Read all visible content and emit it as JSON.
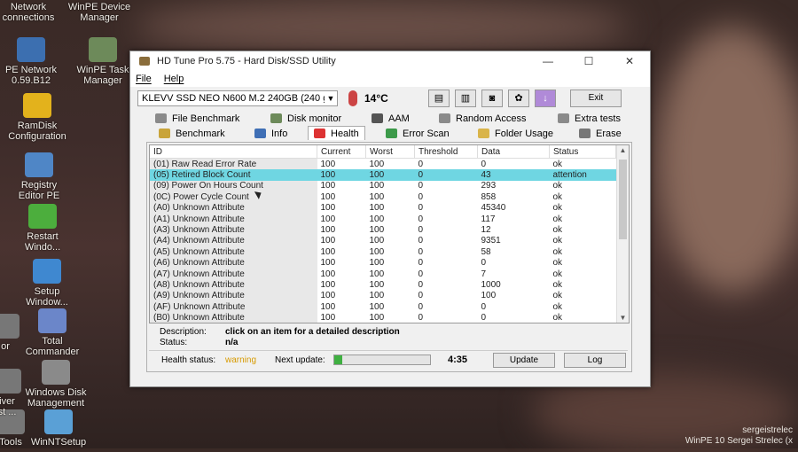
{
  "desktop": {
    "icons": [
      {
        "label1": "Network",
        "label2": "connections",
        "icon": "network-icon",
        "color": "#4a7fbf"
      },
      {
        "label1": "WinPE Device",
        "label2": "Manager",
        "icon": "device-manager-icon",
        "color": "#7a8ea8"
      },
      {
        "label1": "PE Network",
        "label2": "0.59.B12",
        "icon": "pe-network-icon",
        "color": "#3c6fb0"
      },
      {
        "label1": "WinPE Task",
        "label2": "Manager",
        "icon": "task-manager-icon",
        "color": "#6d8a5a"
      },
      {
        "label1": "RamDisk",
        "label2": "Configuration",
        "icon": "ramdisk-icon",
        "color": "#e3b21c"
      },
      {
        "label1": "Registry",
        "label2": "Editor PE",
        "icon": "registry-icon",
        "color": "#4f86c6"
      },
      {
        "label1": "Restart",
        "label2": "Windo...",
        "icon": "restart-icon",
        "color": "#4cae3d"
      },
      {
        "label1": "Setup",
        "label2": "Window...",
        "icon": "setup-icon",
        "color": "#3f88d0"
      },
      {
        "label1": "Total",
        "label2": "Commander",
        "icon": "total-commander-icon",
        "color": "#6b86c9"
      },
      {
        "label1": "Windows Disk",
        "label2": "Management",
        "icon": "disk-management-icon",
        "color": "#8a8a8a"
      },
      {
        "label1": "WinNTSetup",
        "label2": "",
        "icon": "winntsetup-icon",
        "color": "#5aa0d6"
      },
      {
        "label1": "Tools",
        "label2": "",
        "icon": "tools-icon",
        "color": "#777"
      },
      {
        "label1": "iver",
        "label2": "st ...",
        "icon": "driver-icon",
        "color": "#777"
      },
      {
        "label1": "or",
        "label2": "",
        "icon": "partial-icon",
        "color": "#777"
      }
    ],
    "tray_line1": "sergeistrelec",
    "tray_line2": "WinPE 10 Sergei Strelec (x"
  },
  "window": {
    "title": "HD Tune Pro 5.75 - Hard Disk/SSD Utility",
    "minimize": "—",
    "maximize": "☐",
    "close": "✕",
    "menu": [
      "File",
      "Help"
    ],
    "drive": "KLEVV SSD NEO N600 M.2 240GB (240 g",
    "temperature": "14°C",
    "exit_label": "Exit",
    "tabs_top": [
      "File Benchmark",
      "Disk monitor",
      "AAM",
      "Random Access",
      "Extra tests"
    ],
    "tabs_bottom": [
      "Benchmark",
      "Info",
      "Health",
      "Error Scan",
      "Folder Usage",
      "Erase"
    ],
    "active_tab": "Health"
  },
  "health": {
    "columns": [
      "ID",
      "Current",
      "Worst",
      "Threshold",
      "Data",
      "Status"
    ],
    "rows": [
      {
        "id": "(01) Raw Read Error Rate",
        "current": "100",
        "worst": "100",
        "threshold": "0",
        "data": "0",
        "status": "ok"
      },
      {
        "id": "(05) Retired Block Count",
        "current": "100",
        "worst": "100",
        "threshold": "0",
        "data": "43",
        "status": "attention"
      },
      {
        "id": "(09) Power On Hours Count",
        "current": "100",
        "worst": "100",
        "threshold": "0",
        "data": "293",
        "status": "ok"
      },
      {
        "id": "(0C) Power Cycle Count",
        "current": "100",
        "worst": "100",
        "threshold": "0",
        "data": "858",
        "status": "ok"
      },
      {
        "id": "(A0) Unknown Attribute",
        "current": "100",
        "worst": "100",
        "threshold": "0",
        "data": "45340",
        "status": "ok"
      },
      {
        "id": "(A1) Unknown Attribute",
        "current": "100",
        "worst": "100",
        "threshold": "0",
        "data": "117",
        "status": "ok"
      },
      {
        "id": "(A3) Unknown Attribute",
        "current": "100",
        "worst": "100",
        "threshold": "0",
        "data": "12",
        "status": "ok"
      },
      {
        "id": "(A4) Unknown Attribute",
        "current": "100",
        "worst": "100",
        "threshold": "0",
        "data": "9351",
        "status": "ok"
      },
      {
        "id": "(A5) Unknown Attribute",
        "current": "100",
        "worst": "100",
        "threshold": "0",
        "data": "58",
        "status": "ok"
      },
      {
        "id": "(A6) Unknown Attribute",
        "current": "100",
        "worst": "100",
        "threshold": "0",
        "data": "0",
        "status": "ok"
      },
      {
        "id": "(A7) Unknown Attribute",
        "current": "100",
        "worst": "100",
        "threshold": "0",
        "data": "7",
        "status": "ok"
      },
      {
        "id": "(A8) Unknown Attribute",
        "current": "100",
        "worst": "100",
        "threshold": "0",
        "data": "1000",
        "status": "ok"
      },
      {
        "id": "(A9) Unknown Attribute",
        "current": "100",
        "worst": "100",
        "threshold": "0",
        "data": "100",
        "status": "ok"
      },
      {
        "id": "(AF) Unknown Attribute",
        "current": "100",
        "worst": "100",
        "threshold": "0",
        "data": "0",
        "status": "ok"
      },
      {
        "id": "(B0) Unknown Attribute",
        "current": "100",
        "worst": "100",
        "threshold": "0",
        "data": "0",
        "status": "ok"
      }
    ],
    "selected_row": 1,
    "description_label": "Description:",
    "description_value": "click on an item for a detailed description",
    "status_label": "Status:",
    "status_value": "n/a",
    "health_status_label": "Health status:",
    "health_status_value": "warning",
    "next_update_label": "Next update:",
    "next_update_progress": 0.08,
    "countdown": "4:35",
    "update_label": "Update",
    "log_label": "Log"
  },
  "colors": {
    "selected_row": "#6fd6e2",
    "warning": "#d79a00",
    "progress": "#3fb041"
  }
}
